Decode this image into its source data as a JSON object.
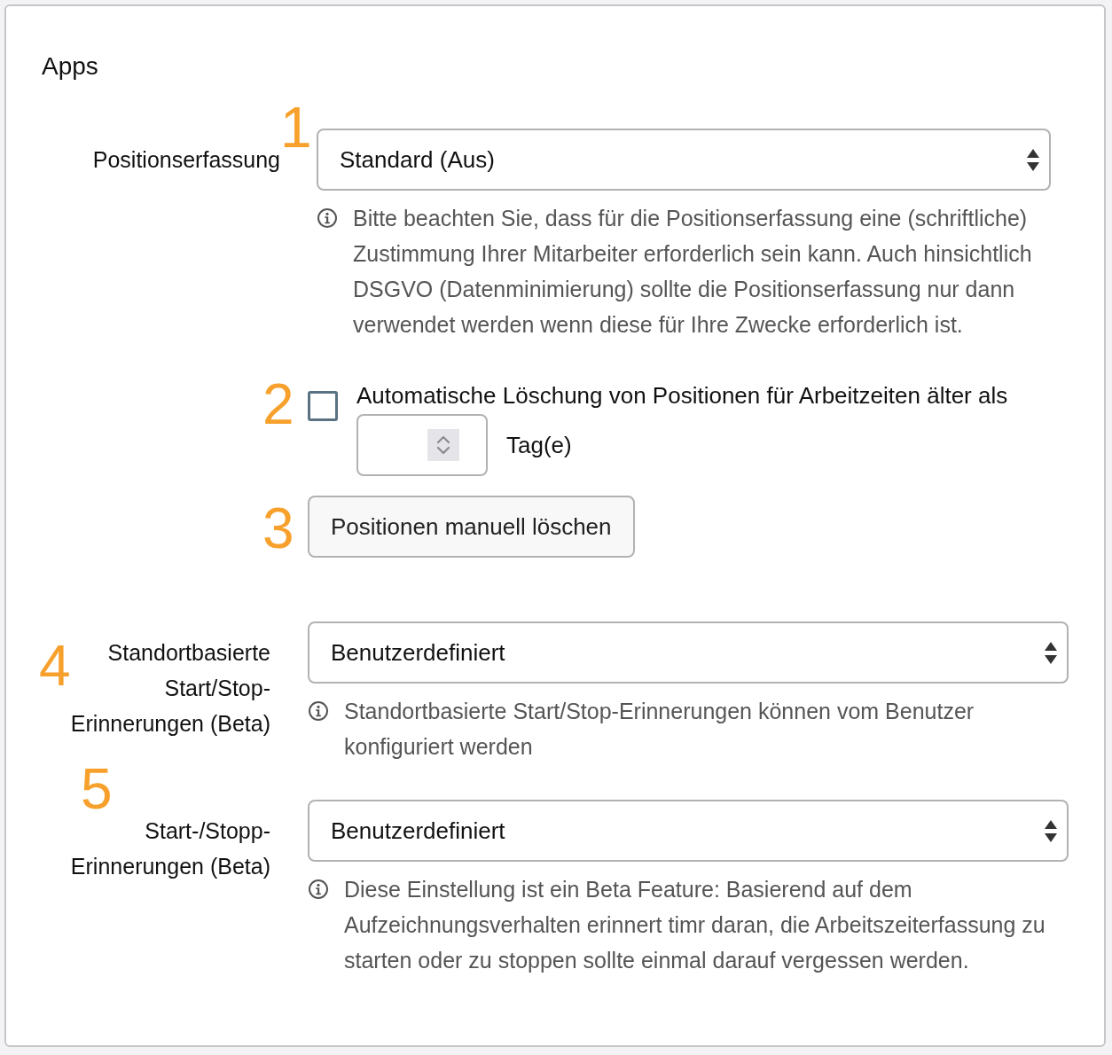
{
  "title": "Apps",
  "settings": [
    {
      "kind": "select",
      "marker": "1",
      "label": "Positionserfassung",
      "value": "Standard (Aus)",
      "help": "Bitte beachten Sie, dass für die Positionserfassung eine (schriftliche) Zustimmung Ihrer Mitarbeiter erforderlich sein kann. Auch hinsichtlich DSGVO (Datenminimierung) sollte die Positionserfassung nur dann verwendet werden wenn diese für Ihre Zwecke erforderlich ist."
    },
    {
      "kind": "checkbox",
      "marker": "2",
      "label": "Automatische Löschung von Positionen für Arbeitzeiten älter als",
      "checked": false,
      "unit": "Tag(e)"
    },
    {
      "kind": "button",
      "marker": "3",
      "label": "Positionen manuell löschen"
    },
    {
      "kind": "select",
      "marker": "4",
      "label": "Standortbasierte Start/Stop-Erinnerungen (Beta)",
      "value": "Benutzerdefiniert",
      "help": "Standortbasierte Start/Stop-Erinnerungen können vom Benutzer konfiguriert werden"
    },
    {
      "kind": "select",
      "marker": "5",
      "label": "Start-/Stopp-Erinnerungen (Beta)",
      "value": "Benutzerdefiniert",
      "help": "Diese Einstellung ist ein Beta Feature: Basierend auf dem Aufzeichnungsverhalten erinnert timr daran, die Arbeitszeiterfassung zu starten oder zu stoppen sollte einmal darauf vergessen werden."
    }
  ]
}
